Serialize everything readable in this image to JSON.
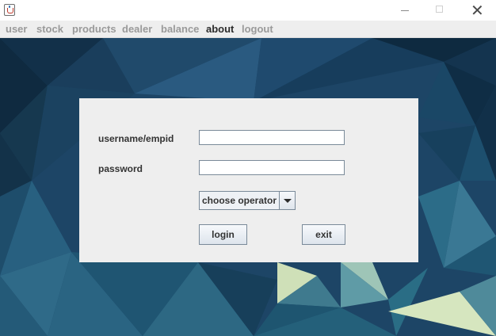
{
  "window": {
    "icon": "java-cup-icon",
    "controls": {
      "minimize": "minimize-icon",
      "maximize": "maximize-icon",
      "close": "✕"
    }
  },
  "menu": {
    "items": [
      {
        "label": "user",
        "active": false
      },
      {
        "label": "stock",
        "active": false
      },
      {
        "label": "products",
        "active": false
      },
      {
        "label": "dealer",
        "active": false
      },
      {
        "label": "balance",
        "active": false
      },
      {
        "label": "about",
        "active": true
      },
      {
        "label": "logout",
        "active": false
      }
    ]
  },
  "login": {
    "username_label": "username/empid",
    "username_value": "",
    "password_label": "password",
    "password_value": "",
    "operator_selected": "choose operator",
    "login_button": "login",
    "exit_button": "exit"
  },
  "colors": {
    "menu_inactive": "#9a9a9a",
    "menu_active": "#2b2b2b",
    "panel_bg": "#eeeeee",
    "background_base": "#1d4566"
  }
}
